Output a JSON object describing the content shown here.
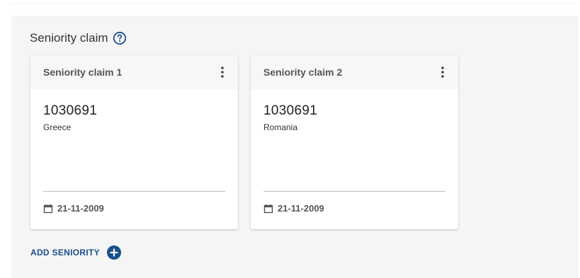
{
  "section": {
    "title": "Seniority claim",
    "help_icon": "help-circle-icon"
  },
  "claims": [
    {
      "title": "Seniority claim 1",
      "number": "1030691",
      "country": "Greece",
      "date": "21-11-2009",
      "menu_icon": "more-vertical-icon",
      "date_icon": "calendar-icon"
    },
    {
      "title": "Seniority claim 2",
      "number": "1030691",
      "country": "Romania",
      "date": "21-11-2009",
      "menu_icon": "more-vertical-icon",
      "date_icon": "calendar-icon"
    }
  ],
  "actions": {
    "add_label": "ADD SENIORITY",
    "add_icon": "plus-circle-icon"
  },
  "colors": {
    "accent": "#1a4f8b",
    "panel_background": "#f5f5f5",
    "card_header_background": "#f7f7f7"
  }
}
